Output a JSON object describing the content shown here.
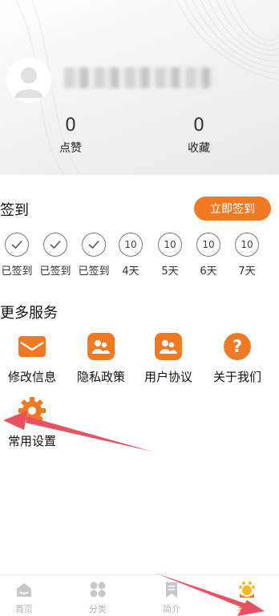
{
  "profile": {
    "likes_count": "0",
    "likes_label": "点赞",
    "favorites_count": "0",
    "favorites_label": "收藏"
  },
  "checkin": {
    "title": "签到",
    "button_label": "立即签到",
    "days": [
      {
        "label": "已签到",
        "status": "done",
        "badge": ""
      },
      {
        "label": "已签到",
        "status": "done",
        "badge": ""
      },
      {
        "label": "已签到",
        "status": "done",
        "badge": ""
      },
      {
        "label": "4天",
        "status": "pending",
        "badge": "10"
      },
      {
        "label": "5天",
        "status": "pending",
        "badge": "10"
      },
      {
        "label": "6天",
        "status": "pending",
        "badge": "10"
      },
      {
        "label": "7天",
        "status": "pending",
        "badge": "10"
      }
    ]
  },
  "services": {
    "title": "更多服务",
    "items": [
      {
        "label": "修改信息",
        "icon": "envelope-icon"
      },
      {
        "label": "隐私政策",
        "icon": "users-icon"
      },
      {
        "label": "用户协议",
        "icon": "users-icon"
      },
      {
        "label": "关于我们",
        "icon": "question-icon"
      },
      {
        "label": "常用设置",
        "icon": "gear-icon"
      }
    ]
  },
  "tabbar": {
    "items": [
      {
        "label": "首页",
        "icon": "home-icon",
        "active": false
      },
      {
        "label": "分类",
        "icon": "grid-icon",
        "active": false
      },
      {
        "label": "简介",
        "icon": "bookmark-icon",
        "active": false
      },
      {
        "label": "我的",
        "icon": "sun-icon",
        "active": true
      }
    ]
  },
  "colors": {
    "accent": "#f07a24",
    "annotation_arrow": "#e8515f"
  }
}
